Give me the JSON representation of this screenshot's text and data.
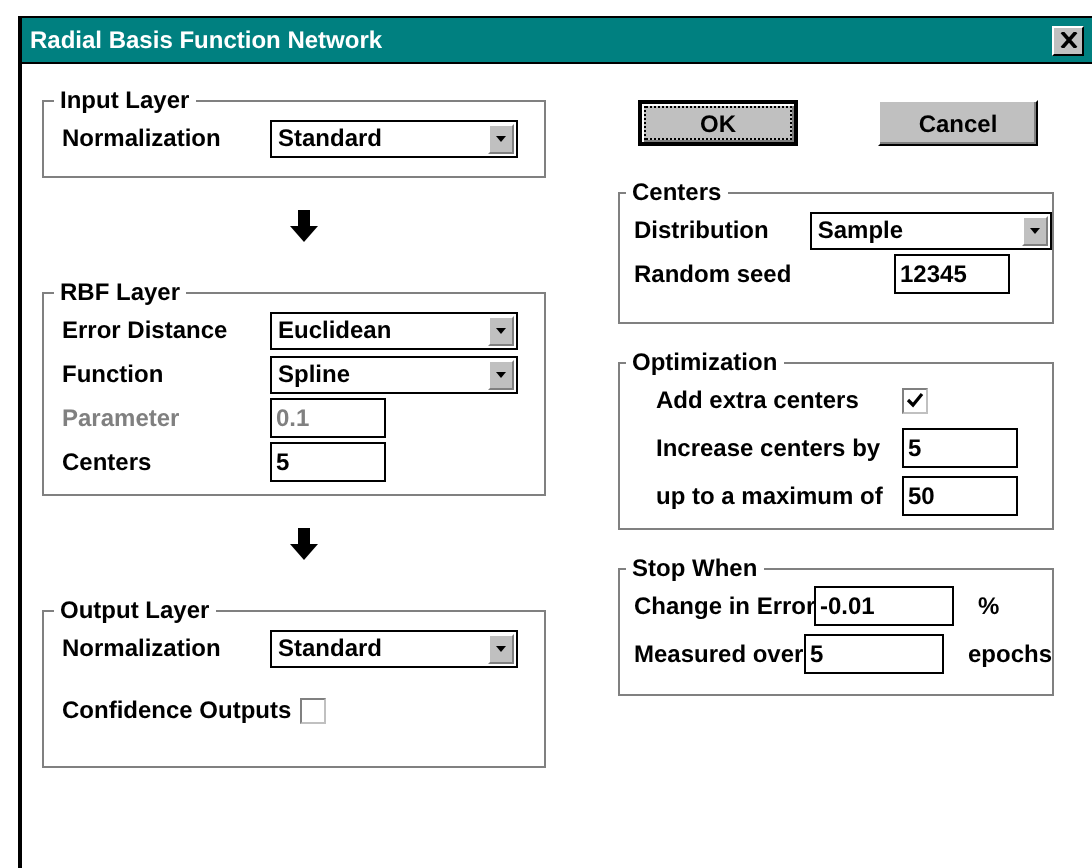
{
  "window": {
    "title": "Radial Basis Function Network"
  },
  "left_groups": [
    {
      "title": "Input Layer",
      "rows": [
        {
          "kind": "dropdown",
          "label": "Normalization",
          "value": "Standard",
          "disabled": false
        }
      ]
    },
    {
      "title": "RBF Layer",
      "rows": [
        {
          "kind": "dropdown",
          "label": "Error Distance",
          "value": "Euclidean",
          "disabled": false
        },
        {
          "kind": "dropdown",
          "label": "Function",
          "value": "Spline",
          "disabled": false
        },
        {
          "kind": "field",
          "label": "Parameter",
          "value": "0.1",
          "disabled": true
        },
        {
          "kind": "field",
          "label": "Centers",
          "value": "5",
          "disabled": false
        }
      ]
    },
    {
      "title": "Output Layer",
      "rows": [
        {
          "kind": "dropdown",
          "label": "Normalization",
          "value": "Standard",
          "disabled": false
        },
        {
          "kind": "checkbox",
          "label": "Confidence Outputs",
          "checked": false,
          "disabled": false
        }
      ]
    }
  ],
  "buttons": [
    {
      "label": "OK",
      "focused": true
    },
    {
      "label": "Cancel",
      "focused": false
    }
  ],
  "right_groups": [
    {
      "title": "Centers",
      "rows": [
        {
          "kind": "dropdown",
          "label": "Distribution",
          "value": "Sample",
          "disabled": false
        },
        {
          "kind": "field",
          "label": "Random seed",
          "value": "12345",
          "disabled": false
        }
      ]
    },
    {
      "title": "Optimization",
      "rows": [
        {
          "kind": "checkbox",
          "label": "Add extra centers",
          "checked": true,
          "disabled": false
        },
        {
          "kind": "field",
          "label": "Increase centers by",
          "value": "5",
          "disabled": false
        },
        {
          "kind": "field",
          "label": "up to a maximum of",
          "value": "50",
          "disabled": false
        }
      ]
    },
    {
      "title": "Stop When",
      "rows": [
        {
          "kind": "field",
          "label": "Change in Error",
          "value": "-0.01",
          "unit": "%",
          "disabled": false
        },
        {
          "kind": "field",
          "label": "Measured over",
          "value": "5",
          "unit": "epochs",
          "disabled": false
        }
      ]
    }
  ]
}
